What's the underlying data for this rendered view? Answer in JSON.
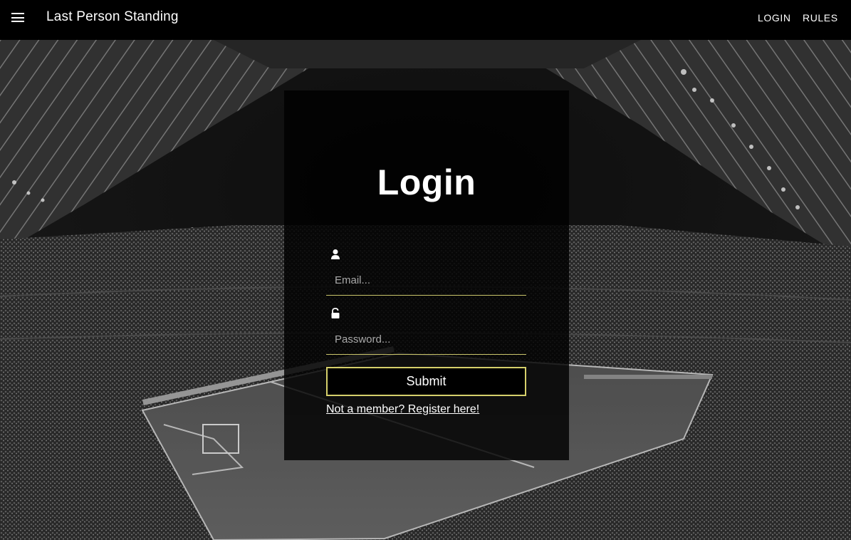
{
  "nav": {
    "menu_icon": "hamburger-menu-icon",
    "title": "Last Person Standing",
    "links": [
      {
        "label": "LOGIN"
      },
      {
        "label": "RULES"
      }
    ]
  },
  "login_card": {
    "title": "Login",
    "email": {
      "icon": "user-icon",
      "placeholder": "Email...",
      "value": ""
    },
    "password": {
      "icon": "unlock-icon",
      "placeholder": "Password...",
      "value": ""
    },
    "submit_label": "Submit",
    "register_link": "Not a member? Register here!"
  },
  "colors": {
    "topbar": "#000000",
    "accent_border": "#d6d06b",
    "card_background": "rgba(0,0,0,0.82)"
  },
  "background": {
    "description_icon": "stadium-photo"
  }
}
